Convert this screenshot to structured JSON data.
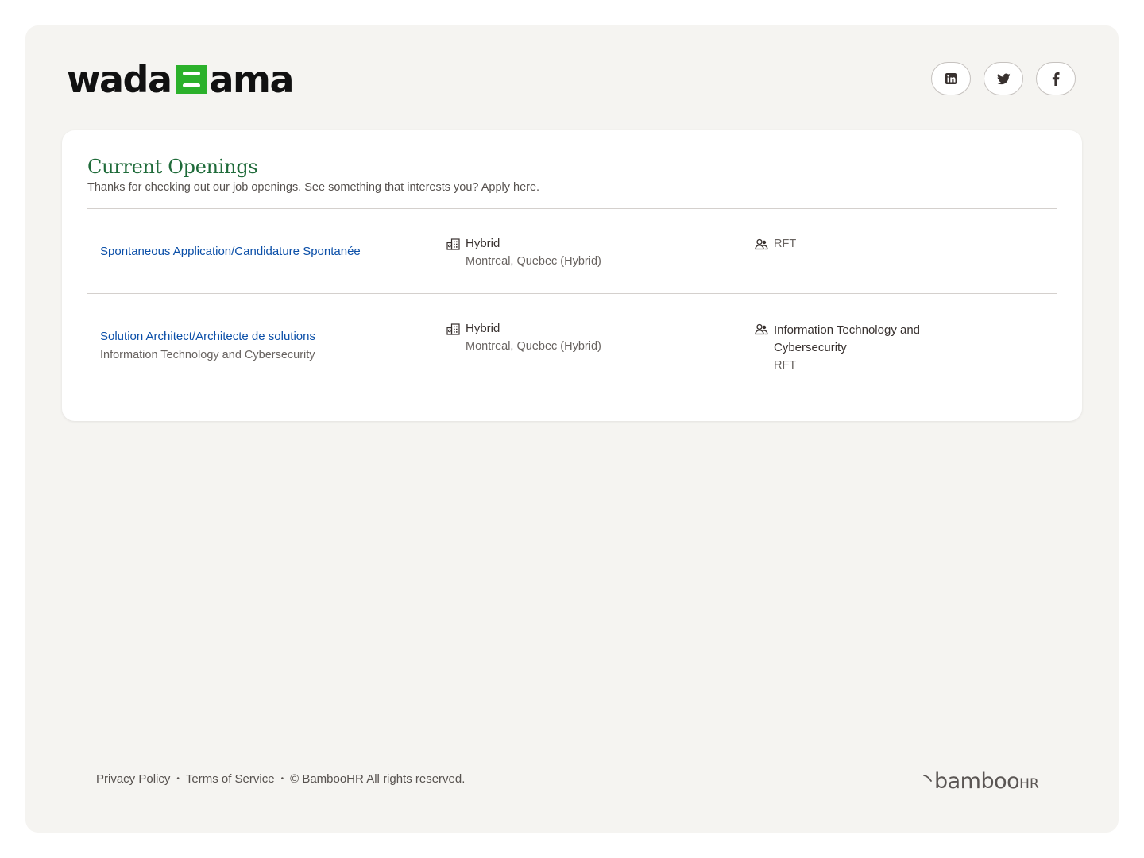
{
  "header": {
    "logo_left": "wada",
    "logo_right": "ama",
    "social": [
      {
        "name": "linkedin-icon"
      },
      {
        "name": "twitter-icon"
      },
      {
        "name": "facebook-icon"
      }
    ]
  },
  "openings": {
    "title": "Current Openings",
    "subtitle": "Thanks for checking out our job openings. See something that interests you? Apply here.",
    "jobs": [
      {
        "title": "Spontaneous Application/Candidature Spontanée",
        "department": "",
        "location_type": "Hybrid",
        "location": "Montreal, Quebec (Hybrid)",
        "team": "",
        "employment": "RFT"
      },
      {
        "title": "Solution Architect/Architecte de solutions",
        "department": "Information Technology and Cybersecurity",
        "location_type": "Hybrid",
        "location": "Montreal, Quebec (Hybrid)",
        "team": "Information Technology and Cybersecurity",
        "employment": "RFT"
      }
    ]
  },
  "footer": {
    "privacy": "Privacy Policy",
    "terms": "Terms of Service",
    "copyright": "© BambooHR All rights reserved.",
    "brand_main": "bamboo",
    "brand_suffix": "HR",
    "bullet": "•"
  },
  "colors": {
    "accent_green": "#1f6b3a",
    "link_blue": "#0b4fa8",
    "logo_green": "#2bb12b"
  }
}
